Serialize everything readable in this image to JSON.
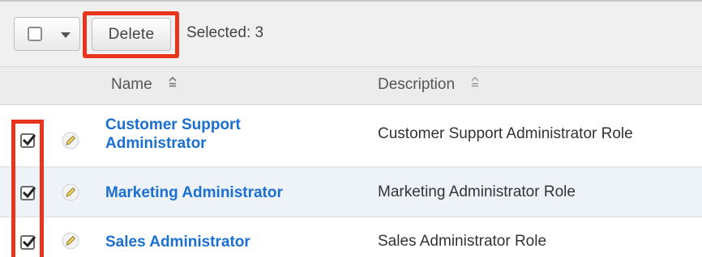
{
  "toolbar": {
    "delete_label": "Delete",
    "selected_text": "Selected: 3"
  },
  "header": {
    "name_label": "Name",
    "description_label": "Description"
  },
  "rows": [
    {
      "name_line1": "Customer Support",
      "name_line2": "Administrator",
      "description": "Customer Support Administrator Role",
      "checked": true
    },
    {
      "name": "Marketing Administrator",
      "description": "Marketing Administrator Role",
      "checked": true
    },
    {
      "name": "Sales Administrator",
      "description": "Sales Administrator Role",
      "checked": true
    }
  ],
  "colors": {
    "highlight": "#e8341c",
    "link": "#1a6fd0",
    "selected_row_bg": "#eef3fa"
  }
}
